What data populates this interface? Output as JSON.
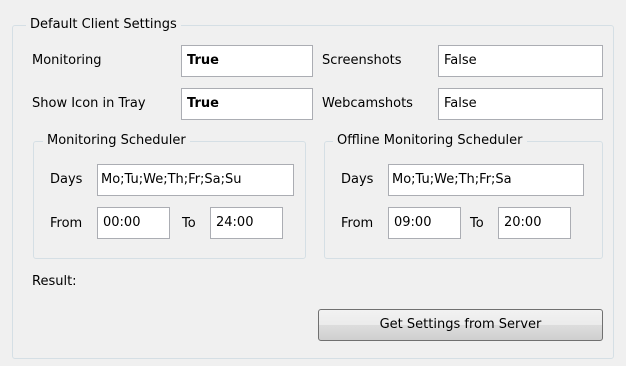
{
  "client_settings": {
    "group_title": "Default Client Settings",
    "monitoring": {
      "label": "Monitoring",
      "value": "True"
    },
    "screenshots": {
      "label": "Screenshots",
      "value": "False"
    },
    "show_icon_in_tray": {
      "label": "Show Icon in Tray",
      "value": "True"
    },
    "webcamshots": {
      "label": "Webcamshots",
      "value": "False"
    }
  },
  "monitoring_scheduler": {
    "title": "Monitoring Scheduler",
    "days_label": "Days",
    "days_value": "Mo;Tu;We;Th;Fr;Sa;Su",
    "from_label": "From",
    "from_value": "00:00",
    "to_label": "To",
    "to_value": "24:00"
  },
  "offline_scheduler": {
    "title": "Offline Monitoring Scheduler",
    "days_label": "Days",
    "days_value": "Mo;Tu;We;Th;Fr;Sa",
    "from_label": "From",
    "from_value": "09:00",
    "to_label": "To",
    "to_value": "20:00"
  },
  "result": {
    "label": "Result:"
  },
  "actions": {
    "get_settings_label": "Get Settings from Server"
  }
}
